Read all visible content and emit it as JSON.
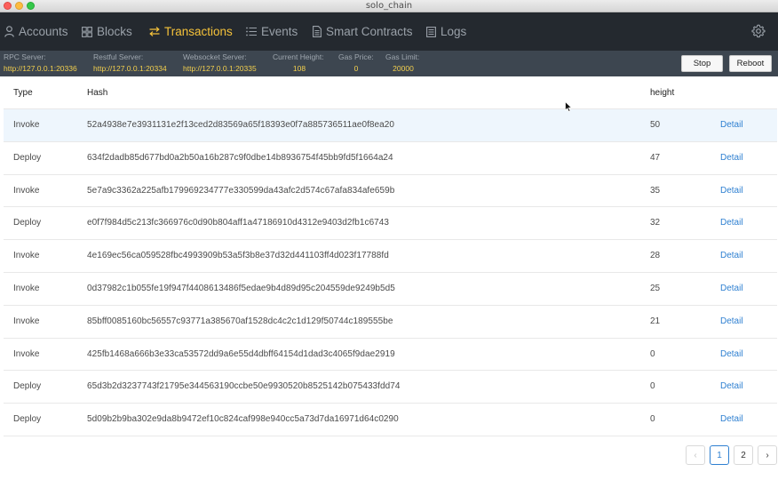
{
  "window": {
    "title": "solo_chain"
  },
  "nav": {
    "items": [
      {
        "label": "Accounts",
        "icon": "person-icon"
      },
      {
        "label": "Blocks",
        "icon": "grid-icon"
      },
      {
        "label": "Transactions",
        "icon": "arrows-swap-icon"
      },
      {
        "label": "Events",
        "icon": "list-icon"
      },
      {
        "label": "Smart Contracts",
        "icon": "document-icon"
      },
      {
        "label": "Logs",
        "icon": "log-icon"
      }
    ],
    "active": "Transactions",
    "settings_icon": "gear-icon"
  },
  "status": {
    "rpc_label": "RPC Server:",
    "rpc_value": "http://127.0.0.1:20336",
    "restful_label": "Restful Server:",
    "restful_value": "http://127.0.0.1:20334",
    "websocket_label": "Websocket Server:",
    "websocket_value": "http://127.0.0.1:20335",
    "height_label": "Current Height:",
    "height_value": "108",
    "gas_price_label": "Gas Price:",
    "gas_price_value": "0",
    "gas_limit_label": "Gas Limit:",
    "gas_limit_value": "20000",
    "stop_label": "Stop",
    "reboot_label": "Reboot"
  },
  "table": {
    "columns": [
      "Type",
      "Hash",
      "height"
    ],
    "rows": [
      {
        "type": "Invoke",
        "hash": "52a4938e7e3931131e2f13ced2d83569a65f18393e0f7a885736511ae0f8ea20",
        "height": "50",
        "action": "Detail"
      },
      {
        "type": "Deploy",
        "hash": "634f2dadb85d677bd0a2b50a16b287c9f0dbe14b8936754f45bb9fd5f1664a24",
        "height": "47",
        "action": "Detail"
      },
      {
        "type": "Invoke",
        "hash": "5e7a9c3362a225afb179969234777e330599da43afc2d574c67afa834afe659b",
        "height": "35",
        "action": "Detail"
      },
      {
        "type": "Deploy",
        "hash": "e0f7f984d5c213fc366976c0d90b804aff1a47186910d4312e9403d2fb1c6743",
        "height": "32",
        "action": "Detail"
      },
      {
        "type": "Invoke",
        "hash": "4e169ec56ca059528fbc4993909b53a5f3b8e37d32d441103ff4d023f17788fd",
        "height": "28",
        "action": "Detail"
      },
      {
        "type": "Invoke",
        "hash": "0d37982c1b055fe19f947f4408613486f5edae9b4d89d95c204559de9249b5d5",
        "height": "25",
        "action": "Detail"
      },
      {
        "type": "Invoke",
        "hash": "85bff0085160bc56557c93771a385670af1528dc4c2c1d129f50744c189555be",
        "height": "21",
        "action": "Detail"
      },
      {
        "type": "Invoke",
        "hash": "425fb1468a666b3e33ca53572dd9a6e55d4dbff64154d1dad3c4065f9dae2919",
        "height": "0",
        "action": "Detail"
      },
      {
        "type": "Deploy",
        "hash": "65d3b2d3237743f21795e344563190ccbe50e9930520b8525142b075433fdd74",
        "height": "0",
        "action": "Detail"
      },
      {
        "type": "Deploy",
        "hash": "5d09b2b9ba302e9da8b9472ef10c824caf998e940cc5a73d7da16971d64c0290",
        "height": "0",
        "action": "Detail"
      }
    ]
  },
  "pagination": {
    "prev": "‹",
    "pages": [
      "1",
      "2"
    ],
    "current": "1",
    "next": "›"
  },
  "colors": {
    "nav_bg": "#24292f",
    "status_bg": "#3d4650",
    "accent": "#f5c23a",
    "link": "#2f80d1"
  }
}
